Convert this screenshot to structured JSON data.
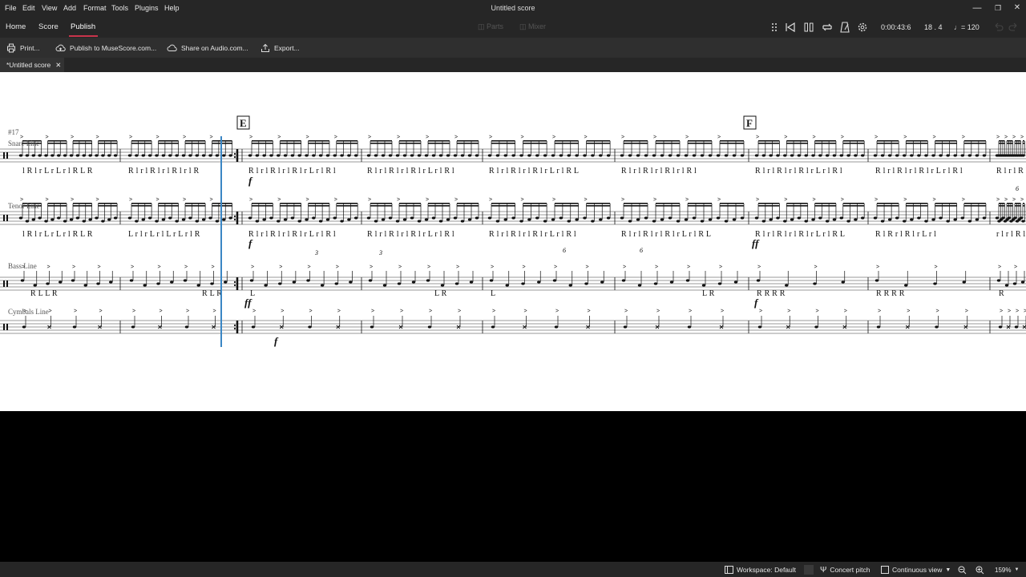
{
  "window": {
    "title": "Untitled score",
    "minimize": "—",
    "maximize": "❐",
    "close": "✕"
  },
  "menu": [
    "File",
    "Edit",
    "View",
    "Add",
    "Format",
    "Tools",
    "Plugins",
    "Help"
  ],
  "nav_tabs": [
    "Home",
    "Score",
    "Publish"
  ],
  "active_tab": "Publish",
  "top_disabled": {
    "parts": "Parts",
    "mixer": "Mixer"
  },
  "playback": {
    "time": "0:00:43:6",
    "measure_beat": "18 . 4",
    "tempo": "= 120"
  },
  "toolbar": {
    "print": "Print...",
    "publish": "Publish to MuseScore.com...",
    "share_audio": "Share on Audio.com...",
    "export": "Export..."
  },
  "document_tab": {
    "title": "*Untitled score"
  },
  "score": {
    "measure_number": "#17",
    "instruments": [
      "Snare Line",
      "Tenor Line",
      "Bass Line",
      "Cymbals Line"
    ],
    "rehearsal_marks": [
      "E",
      "F"
    ],
    "dynamics": {
      "snare_E": "f",
      "tenor_E": "f",
      "tenor_F": "ff",
      "bass_E": "ff",
      "bass_F": "f",
      "cym_E": "f"
    },
    "tuplets": [
      "3",
      "3",
      "6",
      "6",
      "6"
    ],
    "sticking": {
      "snare": [
        "l R l r L r L r l R L R",
        "R l r l R l r l R l r l R",
        "R l r l R l r l R l r L r l R l",
        "R l r l R l r l R l r L r l R l",
        "R l r l R l r l R l r L r l R L",
        "R l r l R l r l R l r l R l",
        "R l r l R l r l R l r L r l R l",
        "R l r l R l r l R l r L r l R l",
        "R l r l R l r L r l R l",
        "R l r l"
      ],
      "tenor": [
        "l R l r L r L r l R L R",
        "L r l r L r l L r L r l R",
        "R l r l R l r l R l r L r l R l",
        "R l r l R l r l R l r L r l R l",
        "R l r l R l r l R l r L r l R l",
        "R l r l R l r l R l r L r l R L",
        "R l r l R l r l R l r L r l R L",
        "R l R r l R l r L r l",
        "r l r l R l l R l r L r l R l L",
        "R l r l"
      ],
      "bass": [
        "R L L R",
        "R L R",
        "L",
        "L R",
        "L",
        "L R",
        "R R R R",
        "R R R R",
        "R"
      ]
    }
  },
  "status": {
    "workspace": "Workspace: Default",
    "concert_pitch": "Concert pitch",
    "view_mode": "Continuous view",
    "zoom": "159%"
  }
}
